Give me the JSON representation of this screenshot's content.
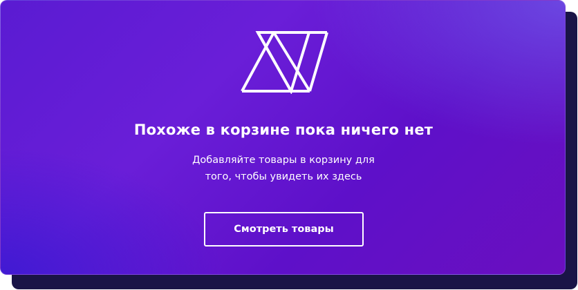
{
  "empty_cart": {
    "logo_icon": "double-triangle-logo-icon",
    "title": "Похоже в корзине пока ничего нет",
    "subtitle_line1": "Добавляйте товары в корзину для",
    "subtitle_line2": "того, чтобы увидеть их здесь",
    "cta_label": "Смотреть товары"
  },
  "colors": {
    "gradient_start": "#5a1bd2",
    "gradient_end": "#6a0fbf",
    "shadow": "#1a1447",
    "text": "#ffffff"
  }
}
